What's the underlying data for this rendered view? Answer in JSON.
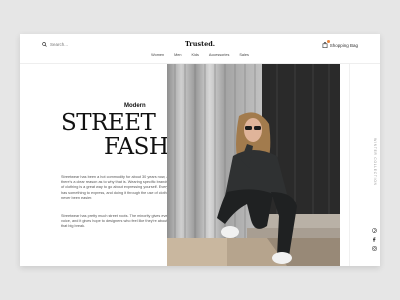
{
  "header": {
    "search_placeholder": "Search...",
    "brand": "Trusted.",
    "nav": [
      "Women",
      "Men",
      "Kids",
      "Accessories",
      "Sales"
    ],
    "bag_label": "Shopping Bag"
  },
  "hero": {
    "kicker": "Modern",
    "title_line1": "STREET",
    "title_line2": "FASHION",
    "paragraph1": "Streetwear has been a hot commodity for about 30 years now, and there's a clear reason as to why that is. Wearing specific brands or types of clothing is a great way to go about expressing yourself. Everybody has something to express, and doing it through the use of clothing has never been easier.",
    "paragraph2": "Streetwear has pretty much street roots. The minority gives everybody a voice, and it gives hope to designers who feel like they're about to make that big break."
  },
  "side": {
    "vertical_label": "WINTER COLLECTION"
  },
  "social": [
    "pinterest-icon",
    "facebook-icon",
    "instagram-icon"
  ],
  "colors": {
    "background": "#e6e6e6",
    "card": "#ffffff",
    "text": "#111111",
    "accent_dot": "#e8833a"
  }
}
